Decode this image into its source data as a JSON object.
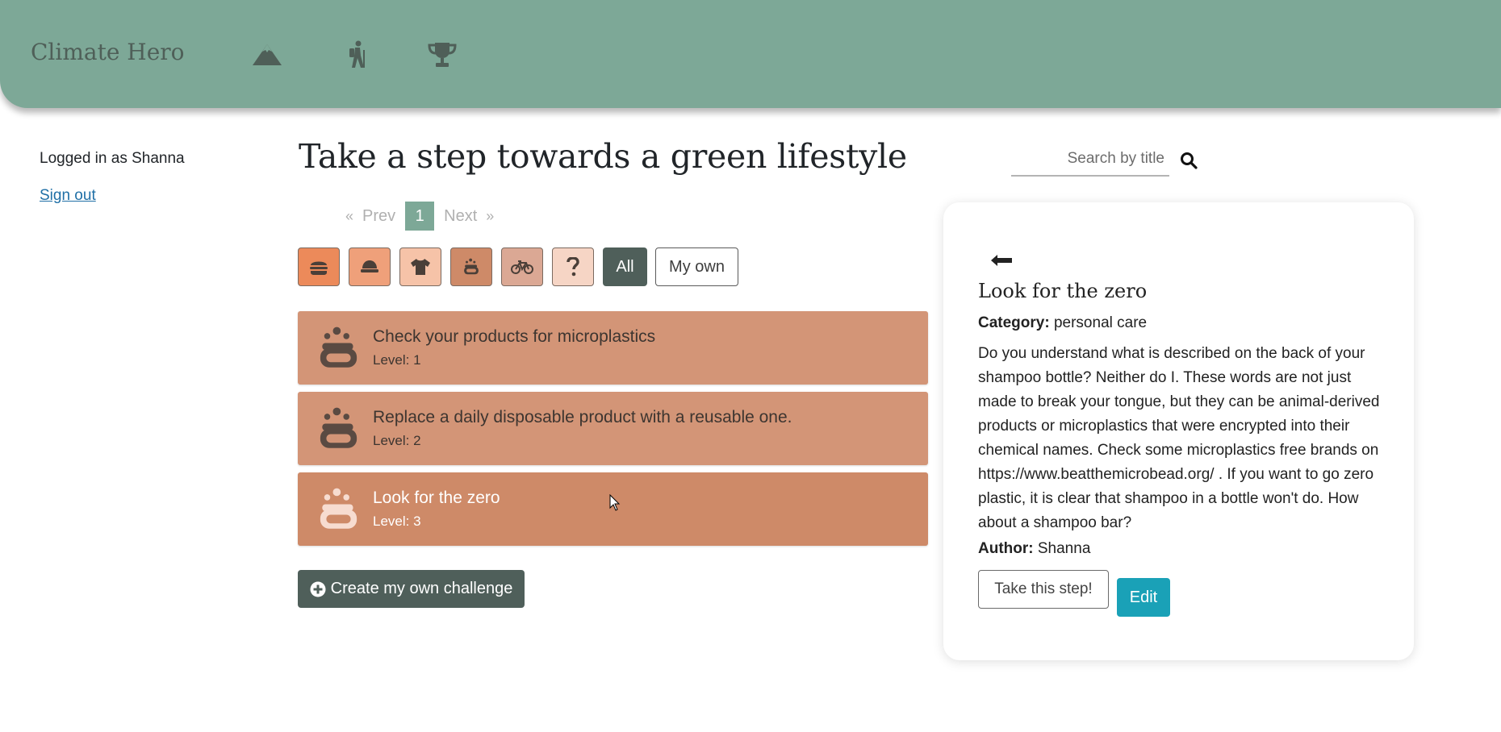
{
  "app": {
    "brand": "Climate Hero"
  },
  "nav": {
    "items": [
      {
        "icon": "mountain-icon"
      },
      {
        "icon": "hiker-icon"
      },
      {
        "icon": "trophy-icon"
      }
    ]
  },
  "sidebar": {
    "logged_in_text": "Logged in as Shanna",
    "sign_out": "Sign out"
  },
  "main": {
    "title": "Take a step towards a green lifestyle"
  },
  "search": {
    "placeholder": "Search by title"
  },
  "pagination": {
    "first": "«",
    "prev": "Prev",
    "current": "1",
    "next": "Next",
    "last": "»"
  },
  "filters": {
    "categories": [
      {
        "icon": "burger-icon",
        "color": "#ec8a5a"
      },
      {
        "icon": "cap-icon",
        "color": "#efa07a"
      },
      {
        "icon": "shirt-icon",
        "color": "#f6c3a8"
      },
      {
        "icon": "soap-icon",
        "color": "#ce8a68"
      },
      {
        "icon": "bicycle-icon",
        "color": "#dba894"
      },
      {
        "icon": "question-icon",
        "color": "#f6d5c5"
      }
    ],
    "all_label": "All",
    "own_label": "My own"
  },
  "challenges": [
    {
      "title": "Check your products for microplastics",
      "level": "Level: 1",
      "icon": "soap-icon"
    },
    {
      "title": "Replace a daily disposable product with a reusable one.",
      "level": "Level: 2",
      "icon": "soap-icon"
    },
    {
      "title": "Look for the zero",
      "level": "Level: 3",
      "icon": "soap-icon"
    }
  ],
  "create_button": "Create my own challenge",
  "detail": {
    "back": "🠔",
    "title": "Look for the zero",
    "category_label": "Category:",
    "category": "personal care",
    "description": "Do you understand what is described on the back of your shampoo bottle? Neither do I. These words are not just made to break your tongue, but they can be animal-derived products or microplastics that were encrypted into their chemical names. Check some microplastics free brands on https://www.beatthemicrobead.org/ . If you want to go zero plastic, it is clear that shampoo in a bottle won't do. How about a shampoo bar?",
    "author_label": "Author:",
    "author": "Shanna",
    "take_button": "Take this step!",
    "edit_button": "Edit"
  },
  "colors": {
    "navbar": "#7da897",
    "challenge_card": "#d39577",
    "challenge_active": "#ce8a68",
    "dark_button": "#4f5f5a",
    "edit_button": "#1aa1b7"
  }
}
